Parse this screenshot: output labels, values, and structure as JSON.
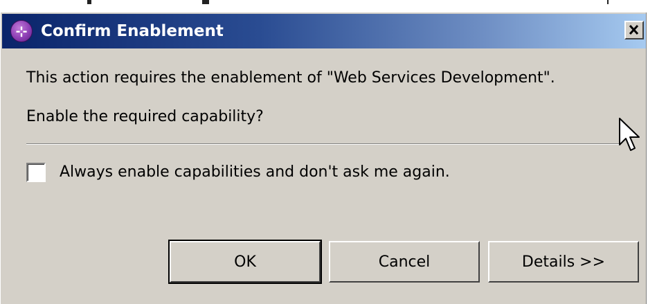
{
  "dialog": {
    "title": "Confirm Enablement",
    "icon": "plug-in-icon",
    "close_glyph": "✕"
  },
  "content": {
    "message_line1": "This action requires the enablement of \"Web Services Development\".",
    "message_line2": "Enable the required capability?"
  },
  "checkbox": {
    "label": "Always enable capabilities and don't ask me again.",
    "checked": false
  },
  "buttons": {
    "ok_label": "OK",
    "cancel_label": "Cancel",
    "details_label": "Details >>"
  },
  "colors": {
    "titlebar_start": "#0a246a",
    "titlebar_end": "#a6caf0",
    "dialog_bg": "#d4d0c8"
  }
}
